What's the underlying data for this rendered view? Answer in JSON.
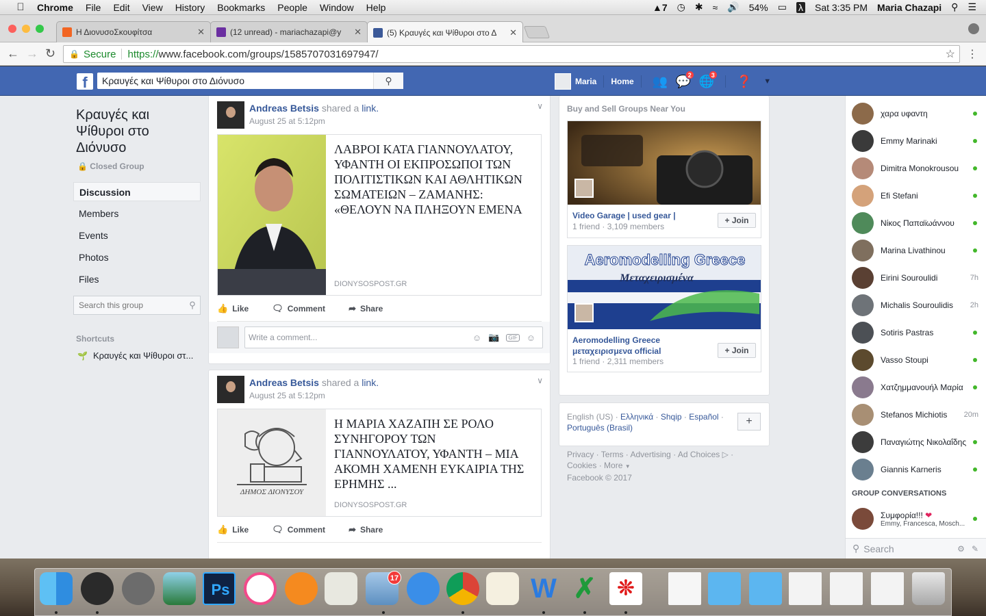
{
  "menubar": {
    "app": "Chrome",
    "items": [
      "File",
      "Edit",
      "View",
      "History",
      "Bookmarks",
      "People",
      "Window",
      "Help"
    ],
    "status": {
      "adobe": "7",
      "battery": "54%",
      "clock": "Sat 3:35 PM",
      "user": "Maria Chazapi"
    }
  },
  "tabs": [
    {
      "title": "Η ΔιονυσοΣκουφίτσα",
      "color": "#f26522"
    },
    {
      "title": "(12 unread) - mariachazapi@y",
      "color": "#6b2fa1"
    },
    {
      "title": "(5) Κραυγές και Ψίθυροι στο Δ",
      "color": "#3b5998"
    }
  ],
  "address": {
    "secure": "Secure",
    "protocol": "https://",
    "url": "www.facebook.com/groups/1585707031697947/"
  },
  "fb": {
    "logo": "f",
    "search_value": "Κραυγές και Ψίθυροι στο Διόνυσο",
    "user": "Maria",
    "home": "Home",
    "messages_badge": "2",
    "notifications_badge": "3"
  },
  "group": {
    "title": "Κραυγές και Ψίθυροι στο Διόνυσο",
    "privacy": "Closed Group",
    "nav": [
      "Discussion",
      "Members",
      "Events",
      "Photos",
      "Files"
    ],
    "search_placeholder": "Search this group",
    "shortcuts_heading": "Shortcuts",
    "shortcut": "Κραυγές και Ψίθυροι στ..."
  },
  "posts": [
    {
      "author": "Andreas Betsis",
      "action": "shared a",
      "object": "link.",
      "time": "August 25 at 5:12pm",
      "headline": "ΛΑΒΡΟΙ ΚΑΤΑ ΓΙΑΝΝΟΥΛΑΤΟΥ, ΥΦΑΝΤΗ ΟΙ ΕΚΠΡΟΣΩΠΟΙ ΤΩΝ ΠΟΛΙΤΙΣΤΙΚΩΝ ΚΑΙ ΑΘΛΗΤΙΚΩΝ ΣΩΜΑΤΕΙΩΝ – ΖΑΜΑΝΗΣ: «ΘΕΛΟΥΝ ΝΑ ΠΛΗΞΟΥΝ ΕΜΕΝΑ",
      "domain": "DIONYSOSPOST.GR"
    },
    {
      "author": "Andreas Betsis",
      "action": "shared a",
      "object": "link.",
      "time": "August 25 at 5:12pm",
      "headline": "Η ΜΑΡΙΑ ΧΑΖΑΠΗ ΣΕ ΡΟΛΟ ΣΥΝΗΓΟΡΟΥ ΤΩΝ ΓΙΑΝΝΟΥΛΑΤΟΥ, ΥΦΑΝΤΗ – ΜΙΑ ΑΚΟΜΗ ΧΑΜΕΝΗ ΕΥΚΑΙΡΙΑ ΤΗΣ ΕΡΗΜΗΣ ...",
      "domain": "DIONYSOSPOST.GR",
      "logo_text": "ΔΗΜΟΣ ΔΙΟΝΥΣΟΥ"
    }
  ],
  "actions": {
    "like": "Like",
    "comment": "Comment",
    "share": "Share",
    "comment_placeholder": "Write a comment..."
  },
  "suggestions": {
    "heading": "Buy and Sell Groups Near You",
    "groups": [
      {
        "name": "Video Garage | used gear |",
        "meta": "1 friend · 3,109 members",
        "join": "+ Join"
      },
      {
        "name": "Aeromodelling Greece μεταχειρισμενα official",
        "meta": "1 friend · 2,311 members",
        "join": "+ Join",
        "banner_title": "Aeromodelling Greece",
        "banner_sub": "Μεταχειρισμένα"
      }
    ]
  },
  "languages": {
    "current": "English (US)",
    "others": [
      "Ελληνικά",
      "Shqip",
      "Español",
      "Português (Brasil)"
    ]
  },
  "footer": {
    "links": [
      "Privacy",
      "Terms",
      "Advertising",
      "Ad Choices",
      "Cookies",
      "More"
    ],
    "copyright": "Facebook © 2017"
  },
  "chat": {
    "contacts": [
      {
        "name": "χαρα υφαντη",
        "status": "online"
      },
      {
        "name": "Emmy Marinaki",
        "status": "online"
      },
      {
        "name": "Dimitra Monokrousou",
        "status": "online"
      },
      {
        "name": "Efi Stefani",
        "status": "online"
      },
      {
        "name": "Νίκος Παπαϊωάννου",
        "status": "online"
      },
      {
        "name": "Marina Livathinou",
        "status": "online"
      },
      {
        "name": "Eirini Souroulidi",
        "status": "7h"
      },
      {
        "name": "Michalis Souroulidis",
        "status": "2h"
      },
      {
        "name": "Sotiris Pastras",
        "status": "online"
      },
      {
        "name": "Vasso Stoupi",
        "status": "online"
      },
      {
        "name": "Χατζημμανουήλ Μαρία",
        "status": "online"
      },
      {
        "name": "Stefanos Michiotis",
        "status": "20m"
      },
      {
        "name": "Παναγιώτης Νικολαΐδης",
        "status": "online"
      },
      {
        "name": "Giannis Karneris",
        "status": "online"
      }
    ],
    "group_heading": "GROUP CONVERSATIONS",
    "group_conv": {
      "title": "Συμφορία!!!",
      "members": "Emmy, Francesca, Mosch..."
    },
    "search_placeholder": "Search"
  },
  "dock": {
    "mail_badge": "17",
    "photoshop": "Ps",
    "word": "W"
  }
}
